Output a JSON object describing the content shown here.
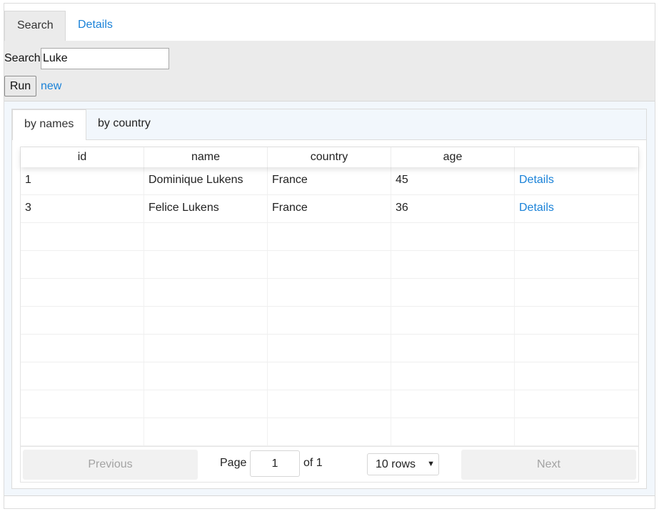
{
  "top_tabs": [
    "Search",
    "Details"
  ],
  "search": {
    "label": "Search",
    "value": "Luke",
    "run_label": "Run",
    "new_label": "new"
  },
  "inner_tabs": [
    "by names",
    "by country"
  ],
  "table": {
    "columns": [
      "id",
      "name",
      "country",
      "age",
      ""
    ],
    "rows": [
      {
        "id": "1",
        "name": "Dominique Lukens",
        "country": "France",
        "age": "45",
        "action": "Details"
      },
      {
        "id": "3",
        "name": "Felice Lukens",
        "country": "France",
        "age": "36",
        "action": "Details"
      }
    ],
    "empty_rows": 8
  },
  "pagination": {
    "previous_label": "Previous",
    "page_label": "Page",
    "page_value": "1",
    "of_label": "of 1",
    "rows_label": "10 rows",
    "next_label": "Next"
  },
  "colors": {
    "link": "#1a82d8",
    "panel": "#ebebeb",
    "inner_panel": "#f2f7fc"
  }
}
